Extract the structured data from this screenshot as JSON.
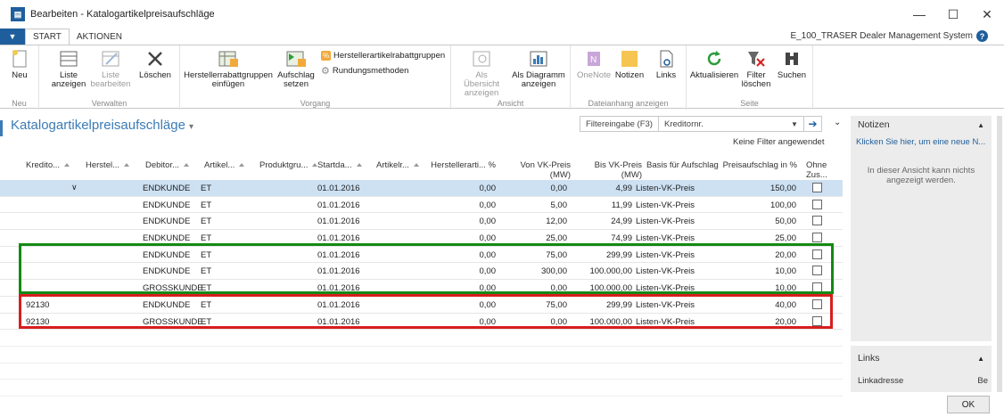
{
  "window": {
    "title": "Bearbeiten - Katalogartikelpreisaufschläge",
    "app_name": "E_100_TRASER Dealer Management System",
    "minimize": "—",
    "maximize": "☐",
    "close": "✕"
  },
  "tabs": [
    "START",
    "AKTIONEN"
  ],
  "ribbon": {
    "groups": {
      "neu": "Neu",
      "verwalten": "Verwalten",
      "vorgang": "Vorgang",
      "ansicht": "Ansicht",
      "dateianhang": "Dateianhang anzeigen",
      "seite": "Seite"
    },
    "buttons": {
      "neu": "Neu",
      "liste_anzeigen": "Liste anzeigen",
      "liste_bearbeiten": "Liste bearbeiten",
      "loeschen": "Löschen",
      "herstellerrabattgruppen_einfuegen": "Herstellerrabattgruppen einfügen",
      "aufschlag_setzen": "Aufschlag setzen",
      "herstellerartikelrabattgruppen": "Herstellerartikelrabattgruppen",
      "rundungsmethoden": "Rundungsmethoden",
      "als_uebersicht": "Als Übersicht anzeigen",
      "als_diagramm": "Als Diagramm anzeigen",
      "onenote": "OneNote",
      "notizen": "Notizen",
      "links": "Links",
      "aktualisieren": "Aktualisieren",
      "filter_loeschen": "Filter löschen",
      "suchen": "Suchen"
    }
  },
  "page": {
    "title": "Katalogartikelpreisaufschläge",
    "filter_label": "Filtereingabe (F3)",
    "filter_field": "Kreditornr.",
    "no_filter": "Keine Filter angewendet"
  },
  "columns": [
    "Kredito...",
    "Herstel...",
    "Debitor...",
    "Artikel...",
    "Produktgru...",
    "Startda...",
    "Artikelr...",
    "Herstellerarti... %",
    "Von VK-Preis (MW)",
    "Bis VK-Preis (MW)",
    "Basis für Aufschlag",
    "Preisaufschlag in %",
    "Ohne Zus..."
  ],
  "rows": [
    {
      "kreditor": "",
      "debitor": "ENDKUNDE",
      "artikel": "ET",
      "startdatum": "01.01.2016",
      "hersteller_pct": "0,00",
      "von": "0,00",
      "bis": "4,99",
      "basis": "Listen-VK-Preis",
      "aufschlag": "150,00"
    },
    {
      "kreditor": "",
      "debitor": "ENDKUNDE",
      "artikel": "ET",
      "startdatum": "01.01.2016",
      "hersteller_pct": "0,00",
      "von": "5,00",
      "bis": "11,99",
      "basis": "Listen-VK-Preis",
      "aufschlag": "100,00"
    },
    {
      "kreditor": "",
      "debitor": "ENDKUNDE",
      "artikel": "ET",
      "startdatum": "01.01.2016",
      "hersteller_pct": "0,00",
      "von": "12,00",
      "bis": "24,99",
      "basis": "Listen-VK-Preis",
      "aufschlag": "50,00"
    },
    {
      "kreditor": "",
      "debitor": "ENDKUNDE",
      "artikel": "ET",
      "startdatum": "01.01.2016",
      "hersteller_pct": "0,00",
      "von": "25,00",
      "bis": "74,99",
      "basis": "Listen-VK-Preis",
      "aufschlag": "25,00"
    },
    {
      "kreditor": "",
      "debitor": "ENDKUNDE",
      "artikel": "ET",
      "startdatum": "01.01.2016",
      "hersteller_pct": "0,00",
      "von": "75,00",
      "bis": "299,99",
      "basis": "Listen-VK-Preis",
      "aufschlag": "20,00"
    },
    {
      "kreditor": "",
      "debitor": "ENDKUNDE",
      "artikel": "ET",
      "startdatum": "01.01.2016",
      "hersteller_pct": "0,00",
      "von": "300,00",
      "bis": "100.000,00",
      "basis": "Listen-VK-Preis",
      "aufschlag": "10,00"
    },
    {
      "kreditor": "",
      "debitor": "GROSSKUNDE",
      "artikel": "ET",
      "startdatum": "01.01.2016",
      "hersteller_pct": "0,00",
      "von": "0,00",
      "bis": "100.000,00",
      "basis": "Listen-VK-Preis",
      "aufschlag": "10,00"
    },
    {
      "kreditor": "92130",
      "debitor": "ENDKUNDE",
      "artikel": "ET",
      "startdatum": "01.01.2016",
      "hersteller_pct": "0,00",
      "von": "75,00",
      "bis": "299,99",
      "basis": "Listen-VK-Preis",
      "aufschlag": "40,00"
    },
    {
      "kreditor": "92130",
      "debitor": "GROSSKUNDE",
      "artikel": "ET",
      "startdatum": "01.01.2016",
      "hersteller_pct": "0,00",
      "von": "0,00",
      "bis": "100.000,00",
      "basis": "Listen-VK-Preis",
      "aufschlag": "20,00"
    }
  ],
  "notes_panel": {
    "title": "Notizen",
    "link": "Klicken Sie hier, um eine neue N...",
    "info": "In dieser Ansicht kann nichts angezeigt werden."
  },
  "links_panel": {
    "title": "Links",
    "col1": "Linkadresse",
    "col2": "Be"
  },
  "ok_label": "OK",
  "colors": {
    "accent": "#1f5e9c",
    "title": "#3b7bb5",
    "selected": "#cde1f3",
    "green": "#138a13",
    "red": "#d81e1e"
  }
}
